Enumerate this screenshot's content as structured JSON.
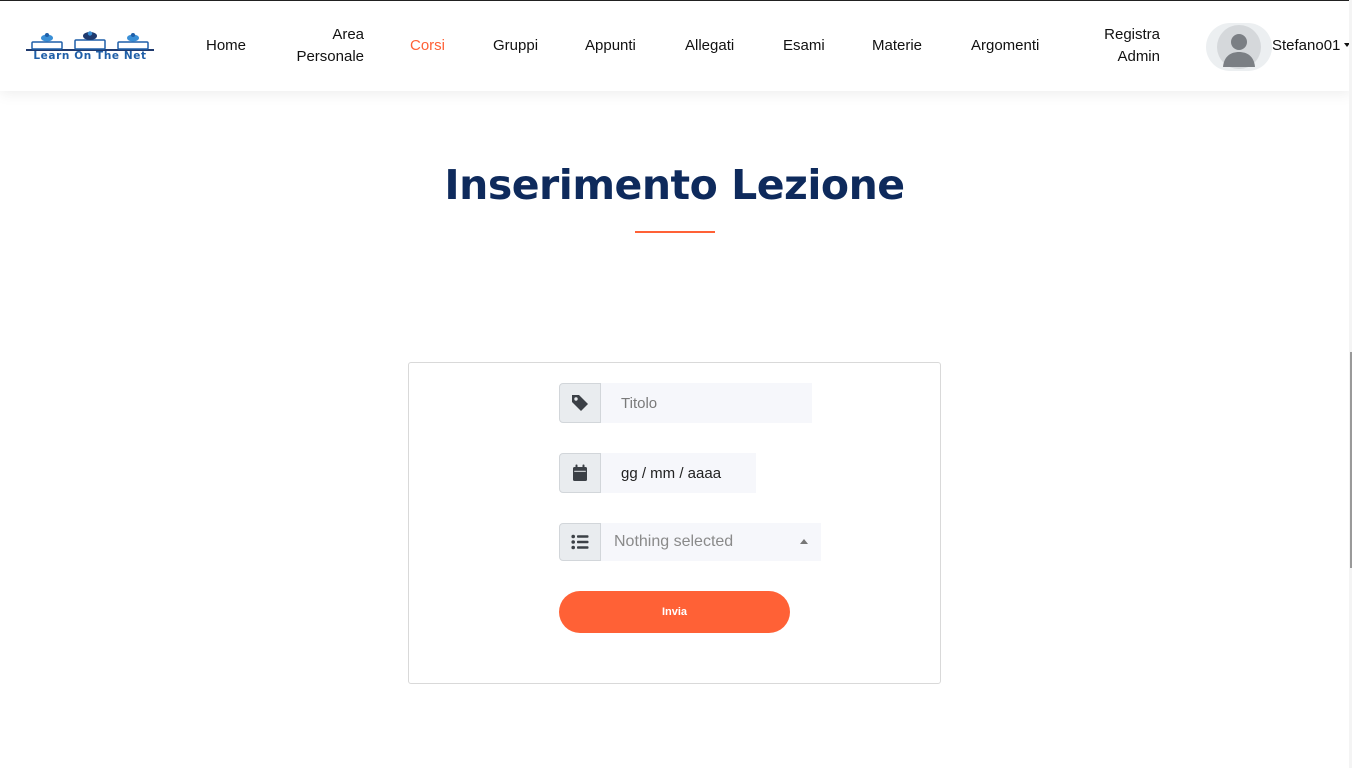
{
  "brand": {
    "logo_text": "Learn On The Net"
  },
  "nav": {
    "items": [
      {
        "label": "Home"
      },
      {
        "label": "Area Personale"
      },
      {
        "label": "Corsi"
      },
      {
        "label": "Gruppi"
      },
      {
        "label": "Appunti"
      },
      {
        "label": "Allegati"
      },
      {
        "label": "Esami"
      },
      {
        "label": "Materie"
      },
      {
        "label": "Argomenti"
      },
      {
        "label": "Registra Admin"
      }
    ],
    "active_item": "Corsi",
    "user": {
      "name": "Stefano01",
      "avatar_icon": "user-silhouette-icon"
    }
  },
  "page": {
    "title": "Inserimento Lezione"
  },
  "form": {
    "titolo": {
      "icon": "tag-icon",
      "placeholder": "Titolo",
      "value": ""
    },
    "data": {
      "icon": "calendar-icon",
      "value": "gg / mm / aaaa"
    },
    "select": {
      "icon": "list-icon",
      "selected": "Nothing selected"
    },
    "submit_label": "Invia"
  },
  "colors": {
    "accent": "#ff6136",
    "title": "#0e2a5c",
    "input_bg": "#f6f7fb",
    "addon_bg": "#e9ecef"
  }
}
